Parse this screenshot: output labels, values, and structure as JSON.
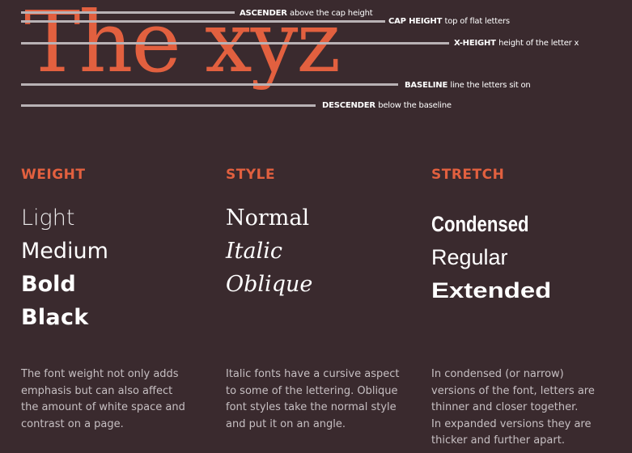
{
  "diagram": {
    "sample_text": "The xyz",
    "guides": [
      {
        "key": "ascender",
        "term": "ASCENDER",
        "desc": "above the cap height"
      },
      {
        "key": "cap_height",
        "term": "CAP HEIGHT",
        "desc": "top of flat letters"
      },
      {
        "key": "x_height",
        "term": "X-HEIGHT",
        "desc": "height of the letter x"
      },
      {
        "key": "baseline",
        "term": "BASELINE",
        "desc": "line the letters sit on"
      },
      {
        "key": "descender",
        "term": "DESCENDER",
        "desc": "below the baseline"
      }
    ]
  },
  "columns": {
    "weight": {
      "heading": "WEIGHT",
      "samples": [
        "Light",
        "Medium",
        "Bold",
        "Black"
      ],
      "description": [
        "The font weight not only adds",
        "emphasis but can also affect",
        "the amount of white space and",
        "contrast on a page."
      ]
    },
    "style": {
      "heading": "STYLE",
      "samples": [
        "Normal",
        "Italic",
        "Oblique"
      ],
      "description": [
        "Italic fonts have a cursive aspect",
        "to some of the lettering. Oblique",
        "font styles take the normal style",
        "and put it on an angle."
      ]
    },
    "stretch": {
      "heading": "STRETCH",
      "samples": [
        "Condensed",
        "Regular",
        "Extended"
      ],
      "description": [
        "In condensed (or narrow)",
        "versions of the font, letters are",
        "thinner and closer together.",
        "In expanded versions they are",
        "thicker and further apart."
      ]
    }
  },
  "colors": {
    "background": "#3a2a2e",
    "accent": "#e2603f",
    "guide_line": "#b9b2b5",
    "text": "#ffffff",
    "muted_text": "#c6bfc2"
  }
}
